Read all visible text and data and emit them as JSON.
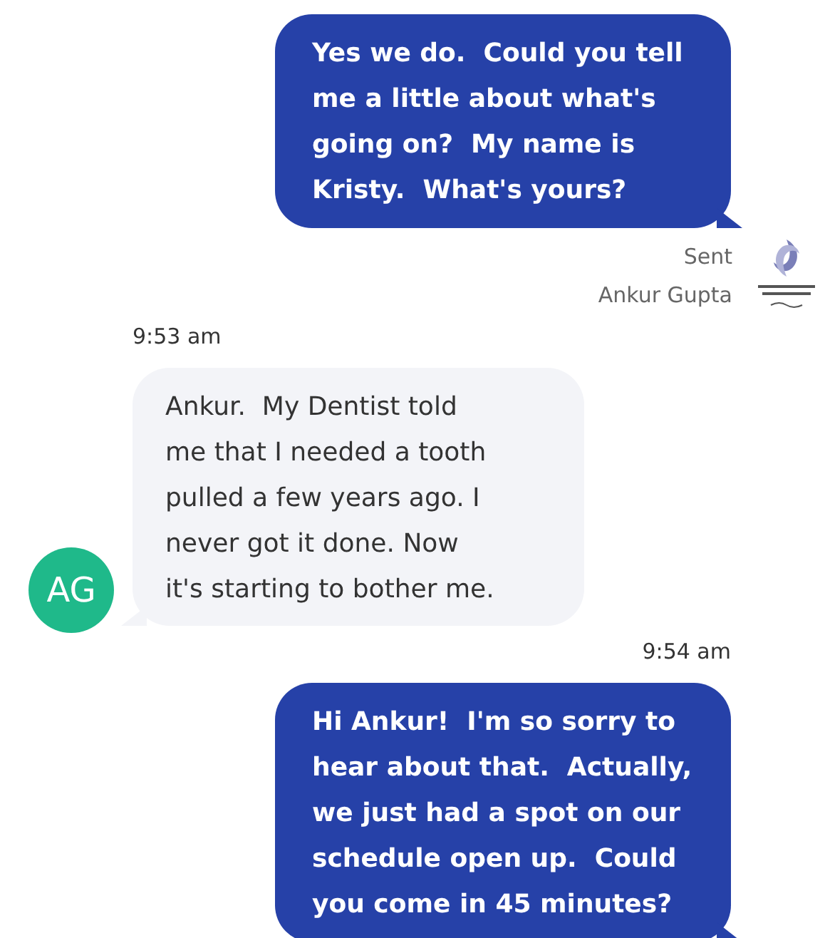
{
  "messages": [
    {
      "kind": "outgoing",
      "text": "Yes we do.  Could you tell\nme a little about what's\ngoing on?  My name is\nKristy.  What's yours?",
      "status": "Sent",
      "sender": "Ankur Gupta",
      "logo": true
    },
    {
      "kind": "incoming",
      "time": "9:53 am",
      "text": "Ankur.  My Dentist told\nme that I needed a tooth\npulled a few years ago. I\nnever got it done. Now\nit's starting to bother me.",
      "avatar": "AG"
    },
    {
      "kind": "outgoing",
      "time": "9:54 am",
      "text": "Hi Ankur!  I'm so sorry to\nhear about that.  Actually,\nwe just had a spot on our\nschedule open up.  Could\nyou come in 45 minutes?"
    }
  ]
}
